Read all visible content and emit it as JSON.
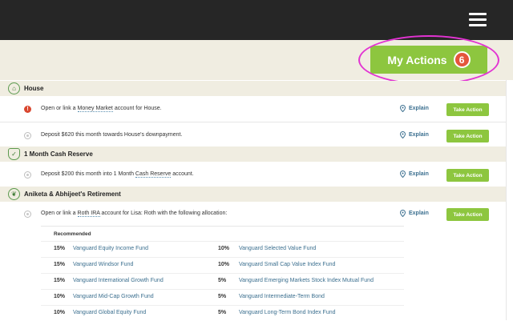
{
  "header": {
    "menu_icon": "hamburger-menu-icon",
    "my_actions_label": "My Actions",
    "my_actions_count": "6",
    "highlight_color": "#e233d2"
  },
  "colors": {
    "accent_green": "#8dc63f",
    "badge_red": "#e4553c",
    "link_blue": "#3b6f8f",
    "section_bg": "#f0ede1"
  },
  "sections": {
    "house": {
      "icon": "house-icon",
      "title": "House"
    },
    "cash_reserve": {
      "icon": "shield-icon",
      "title": "1 Month Cash Reserve"
    },
    "retirement": {
      "icon": "leaf-icon",
      "title": "Aniketa & Abhijeet's Retirement"
    }
  },
  "rows": [
    {
      "status_icon": "alert-icon",
      "text_before": "Open or link a ",
      "link": "Money Market",
      "text_after": " account for House.",
      "explain": "Explain",
      "action": "Take Action"
    },
    {
      "status_icon": "todo-icon",
      "text": "Deposit $620 this month towards House's downpayment.",
      "explain": "Explain",
      "action": "Take Action"
    },
    {
      "status_icon": "todo-icon",
      "text_before": "Deposit $200 this month into 1 Month ",
      "link": "Cash Reserve",
      "text_after": " account.",
      "explain": "Explain",
      "action": "Take Action"
    },
    {
      "status_icon": "todo-icon",
      "text_before": "Open or link a ",
      "link": "Roth IRA",
      "text_after": " account for Lisa: Roth with the following allocation:",
      "explain": "Explain",
      "action": "Take Action"
    }
  ],
  "allocation": {
    "header": "Recommended",
    "left": [
      {
        "pct": "15%",
        "fund": "Vanguard Equity Income Fund"
      },
      {
        "pct": "15%",
        "fund": "Vanguard Windsor Fund"
      },
      {
        "pct": "15%",
        "fund": "Vanguard International Growth Fund"
      },
      {
        "pct": "10%",
        "fund": "Vanguard Mid-Cap Growth Fund"
      },
      {
        "pct": "10%",
        "fund": "Vanguard Global Equity Fund"
      }
    ],
    "right": [
      {
        "pct": "10%",
        "fund": "Vanguard Selected Value Fund"
      },
      {
        "pct": "10%",
        "fund": "Vanguard Small Cap Value Index Fund"
      },
      {
        "pct": "5%",
        "fund": "Vanguard Emerging Markets Stock Index Mutual Fund"
      },
      {
        "pct": "5%",
        "fund": "Vanguard Intermediate-Term Bond"
      },
      {
        "pct": "5%",
        "fund": "Vanguard Long-Term Bond Index Fund"
      }
    ]
  }
}
